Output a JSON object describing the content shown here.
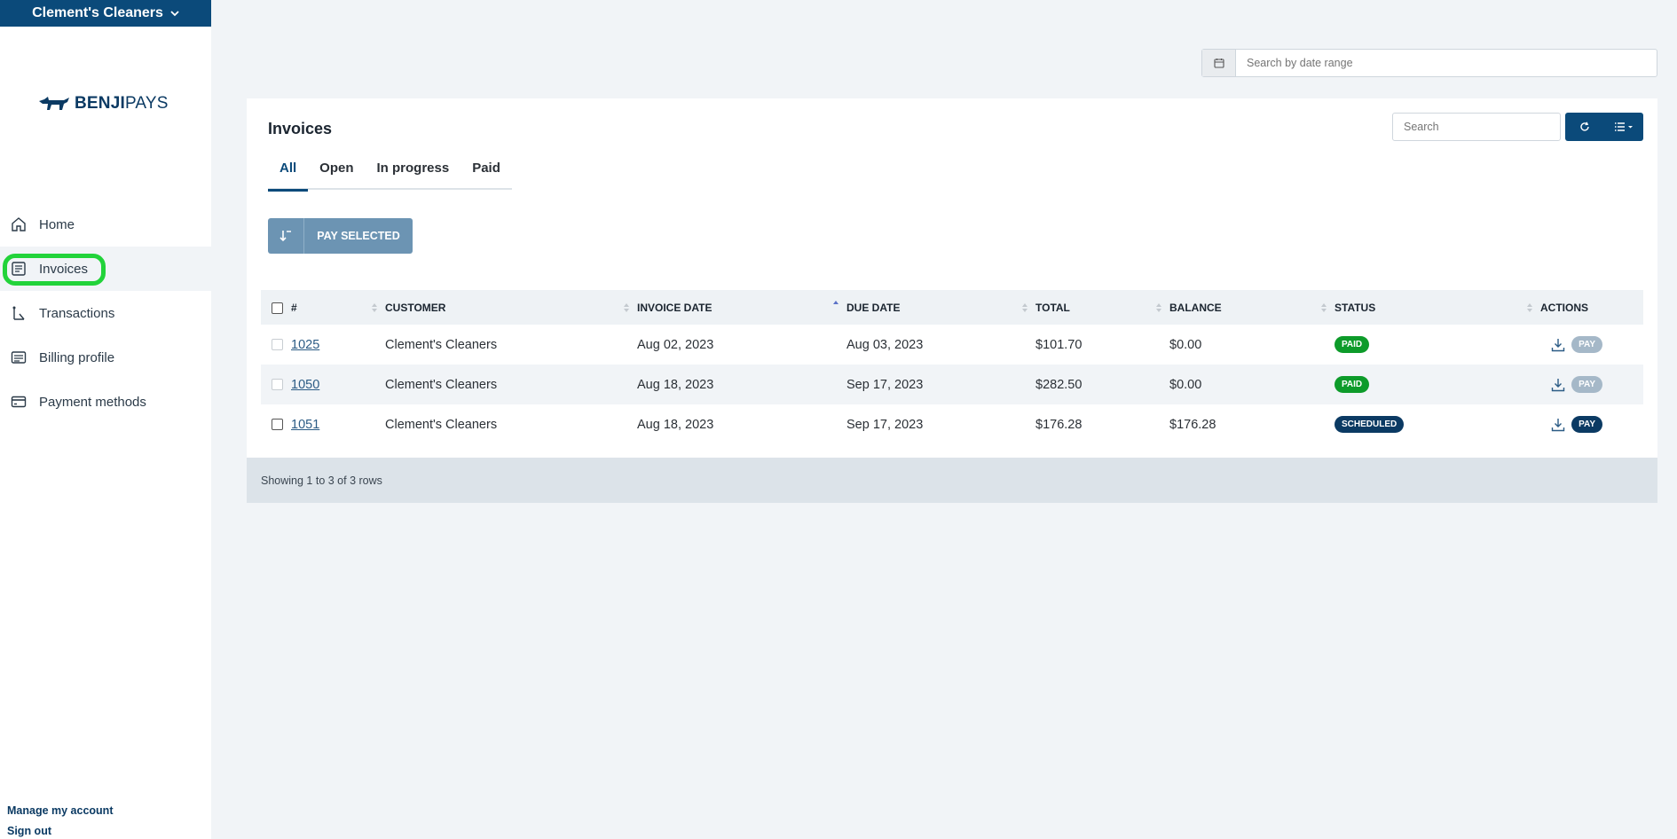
{
  "org": {
    "name": "Clement's Cleaners"
  },
  "brand": {
    "logo_bold": "BENJI",
    "logo_light": "PAYS",
    "color": "#0b4a7a"
  },
  "nav": {
    "items": [
      {
        "label": "Home",
        "icon": "home-icon"
      },
      {
        "label": "Invoices",
        "icon": "invoice-icon",
        "active": true
      },
      {
        "label": "Transactions",
        "icon": "transactions-icon"
      },
      {
        "label": "Billing profile",
        "icon": "billing-icon"
      },
      {
        "label": "Payment methods",
        "icon": "card-icon"
      }
    ]
  },
  "footer_links": {
    "manage": "Manage my account",
    "signout": "Sign out"
  },
  "date_search": {
    "placeholder": "Search by date range"
  },
  "invoices": {
    "title": "Invoices",
    "tabs": [
      "All",
      "Open",
      "In progress",
      "Paid"
    ],
    "active_tab": "All",
    "search_placeholder": "Search",
    "pay_selected_label": "PAY SELECTED",
    "columns": [
      "#",
      "CUSTOMER",
      "INVOICE DATE",
      "DUE DATE",
      "TOTAL",
      "BALANCE",
      "STATUS",
      "ACTIONS"
    ],
    "rows": [
      {
        "number": "1025",
        "customer": "Clement's Cleaners",
        "invoice_date": "Aug 02, 2023",
        "due_date": "Aug 03, 2023",
        "total": "$101.70",
        "balance": "$0.00",
        "status": "PAID",
        "pay": "PAY"
      },
      {
        "number": "1050",
        "customer": "Clement's Cleaners",
        "invoice_date": "Aug 18, 2023",
        "due_date": "Sep 17, 2023",
        "total": "$282.50",
        "balance": "$0.00",
        "status": "PAID",
        "pay": "PAY"
      },
      {
        "number": "1051",
        "customer": "Clement's Cleaners",
        "invoice_date": "Aug 18, 2023",
        "due_date": "Sep 17, 2023",
        "total": "$176.28",
        "balance": "$176.28",
        "status": "SCHEDULED",
        "pay": "PAY"
      }
    ],
    "footer_text": "Showing 1 to 3 of 3 rows"
  },
  "colors": {
    "primary": "#0b4a7a",
    "paid": "#0d9b2a",
    "scheduled": "#0b3a63",
    "highlight": "#22d33a"
  }
}
